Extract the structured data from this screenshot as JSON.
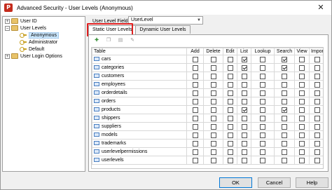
{
  "window": {
    "title": "Advanced Security - User Levels (Anonymous)",
    "app_icon_letter": "P",
    "close_glyph": "✕"
  },
  "tree": {
    "nodes": [
      {
        "label": "User ID",
        "expander": "+",
        "icon": "folder-icon"
      },
      {
        "label": "User Levels",
        "expander": "−",
        "icon": "folder-icon"
      },
      {
        "label": "Anonymous",
        "icon": "key-icon",
        "selected": true
      },
      {
        "label": "Administrator",
        "icon": "key-icon"
      },
      {
        "label": "Default",
        "icon": "key-icon"
      },
      {
        "label": "User Login Options",
        "expander": "+",
        "icon": "folder-icon"
      }
    ]
  },
  "field": {
    "label": "User Level Field",
    "value": "UserLevel"
  },
  "tabs": [
    {
      "label": "Static User Levels",
      "active": true
    },
    {
      "label": "Dynamic User Levels",
      "active": false
    }
  ],
  "toolbar": {
    "icons": [
      "add-icon",
      "copy-icon",
      "paste-icon",
      "edit-icon"
    ]
  },
  "grid": {
    "columns": [
      "Table",
      "Add",
      "Delete",
      "Edit",
      "List",
      "Lookup",
      "Search",
      "View",
      "Import"
    ],
    "rows": [
      {
        "name": "cars",
        "checks": [
          false,
          false,
          false,
          true,
          false,
          true,
          false,
          false
        ]
      },
      {
        "name": "categories",
        "checks": [
          false,
          false,
          false,
          true,
          false,
          true,
          false,
          false
        ]
      },
      {
        "name": "customers",
        "checks": [
          false,
          false,
          false,
          false,
          false,
          false,
          false,
          false
        ]
      },
      {
        "name": "employees",
        "checks": [
          false,
          false,
          false,
          false,
          false,
          false,
          false,
          false
        ]
      },
      {
        "name": "orderdetails",
        "checks": [
          false,
          false,
          false,
          false,
          false,
          false,
          false,
          false
        ]
      },
      {
        "name": "orders",
        "checks": [
          false,
          false,
          false,
          false,
          false,
          false,
          false,
          false
        ]
      },
      {
        "name": "products",
        "checks": [
          false,
          false,
          false,
          true,
          false,
          true,
          false,
          false
        ]
      },
      {
        "name": "shippers",
        "checks": [
          false,
          false,
          false,
          false,
          false,
          false,
          false,
          false
        ]
      },
      {
        "name": "suppliers",
        "checks": [
          false,
          false,
          false,
          false,
          false,
          false,
          false,
          false
        ]
      },
      {
        "name": "models",
        "checks": [
          false,
          false,
          false,
          false,
          false,
          false,
          false,
          false
        ]
      },
      {
        "name": "trademarks",
        "checks": [
          false,
          false,
          false,
          false,
          false,
          false,
          false,
          false
        ]
      },
      {
        "name": "userlevelpermissions",
        "checks": [
          false,
          false,
          false,
          false,
          false,
          false,
          false,
          false
        ]
      },
      {
        "name": "userlevels",
        "checks": [
          false,
          false,
          false,
          false,
          false,
          false,
          false,
          false
        ]
      }
    ]
  },
  "footer": {
    "ok": "OK",
    "cancel": "Cancel",
    "help": "Help"
  },
  "colors": {
    "highlight_box": "#e02020",
    "selection": "#cce8ff"
  }
}
